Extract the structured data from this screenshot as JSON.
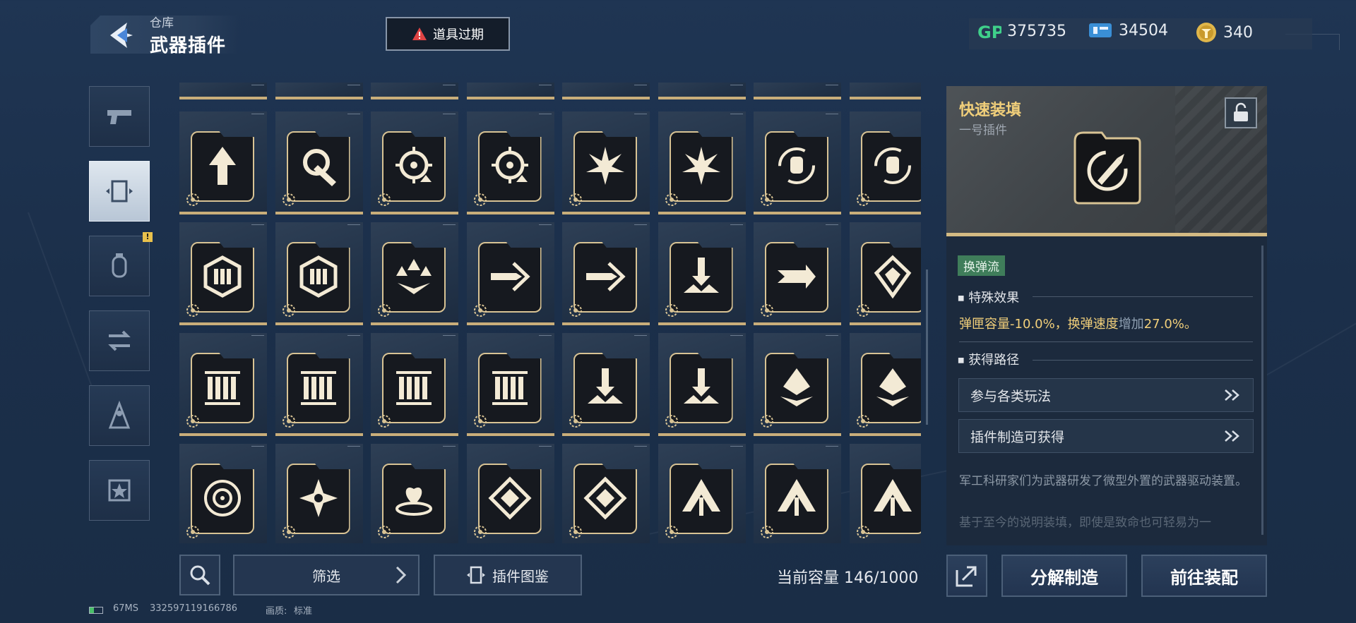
{
  "header": {
    "breadcrumb_parent": "仓库",
    "title": "武器插件",
    "expire_label": "道具过期",
    "currencies": [
      {
        "icon": "gp-icon",
        "value": "375735"
      },
      {
        "icon": "ticket-icon",
        "value": "34504"
      },
      {
        "icon": "gold-coin-icon",
        "value": "340"
      }
    ]
  },
  "sidebar": {
    "items": [
      {
        "icon": "pistol-icon",
        "active": false,
        "alert": false
      },
      {
        "icon": "plugin-card-icon",
        "active": true,
        "alert": false
      },
      {
        "icon": "grenade-icon",
        "active": false,
        "alert": true
      },
      {
        "icon": "transfer-icon",
        "active": false,
        "alert": false
      },
      {
        "icon": "character-icon",
        "active": false,
        "alert": false
      },
      {
        "icon": "star-badge-icon",
        "active": false,
        "alert": false
      }
    ]
  },
  "grid": {
    "columns": 8,
    "rows": [
      [
        "up-arrow-icon",
        "drill-strike-icon",
        "crosshair-up-icon",
        "crosshair-up-icon",
        "burst-up-icon",
        "burst-up-icon",
        "hand-cycle-icon",
        "hand-cycle-icon"
      ],
      [
        "ammo-hex-icon",
        "ammo-hex-icon",
        "triple-arrow-icon",
        "dash-bullet-icon",
        "dash-bullet-icon",
        "impact-down-icon",
        "speed-arrows-icon",
        "gem-shield-icon"
      ],
      [
        "ammo-belt-icon",
        "ammo-belt-icon",
        "ammo-belt-icon",
        "ammo-belt-icon",
        "impact-down-icon",
        "impact-down-icon",
        "crystal-drop-icon",
        "crystal-drop-icon"
      ],
      [
        "target-ring-icon",
        "spark-star-icon",
        "heart-drop-icon",
        "diamond-cross-icon",
        "diamond-cross-icon",
        "spread-up-icon",
        "spread-up-icon",
        "spread-up-icon"
      ]
    ]
  },
  "bottom": {
    "filter_label": "筛选",
    "codex_label": "插件图鉴",
    "capacity": "当前容量 146/1000",
    "disassemble_label": "分解制造",
    "equip_label": "前往装配",
    "status": {
      "ping": "67MS",
      "uid": "332597119166786",
      "quality_label": "画质:",
      "quality_value": "标准"
    }
  },
  "detail": {
    "name": "快速装填",
    "slot": "一号插件",
    "tag": "换弹流",
    "effect_title": "特殊效果",
    "effect_part1": "弹匣容量-10.0%，换弹速度",
    "effect_part2": "增加",
    "effect_part3": "27.0%。",
    "source_title": "获得路径",
    "sources": [
      "参与各类玩法",
      "插件制造可获得"
    ],
    "description": "军工科研家们为武器研发了微型外置的武器驱动装置。",
    "description_faint": "基于至今的说明装填，即使是致命也可轻易为一"
  },
  "colors": {
    "accent_gold": "#f1cf7a",
    "tile_border": "#d8c394",
    "tag_green": "#3f7d5a",
    "alert_red": "#e04444"
  }
}
